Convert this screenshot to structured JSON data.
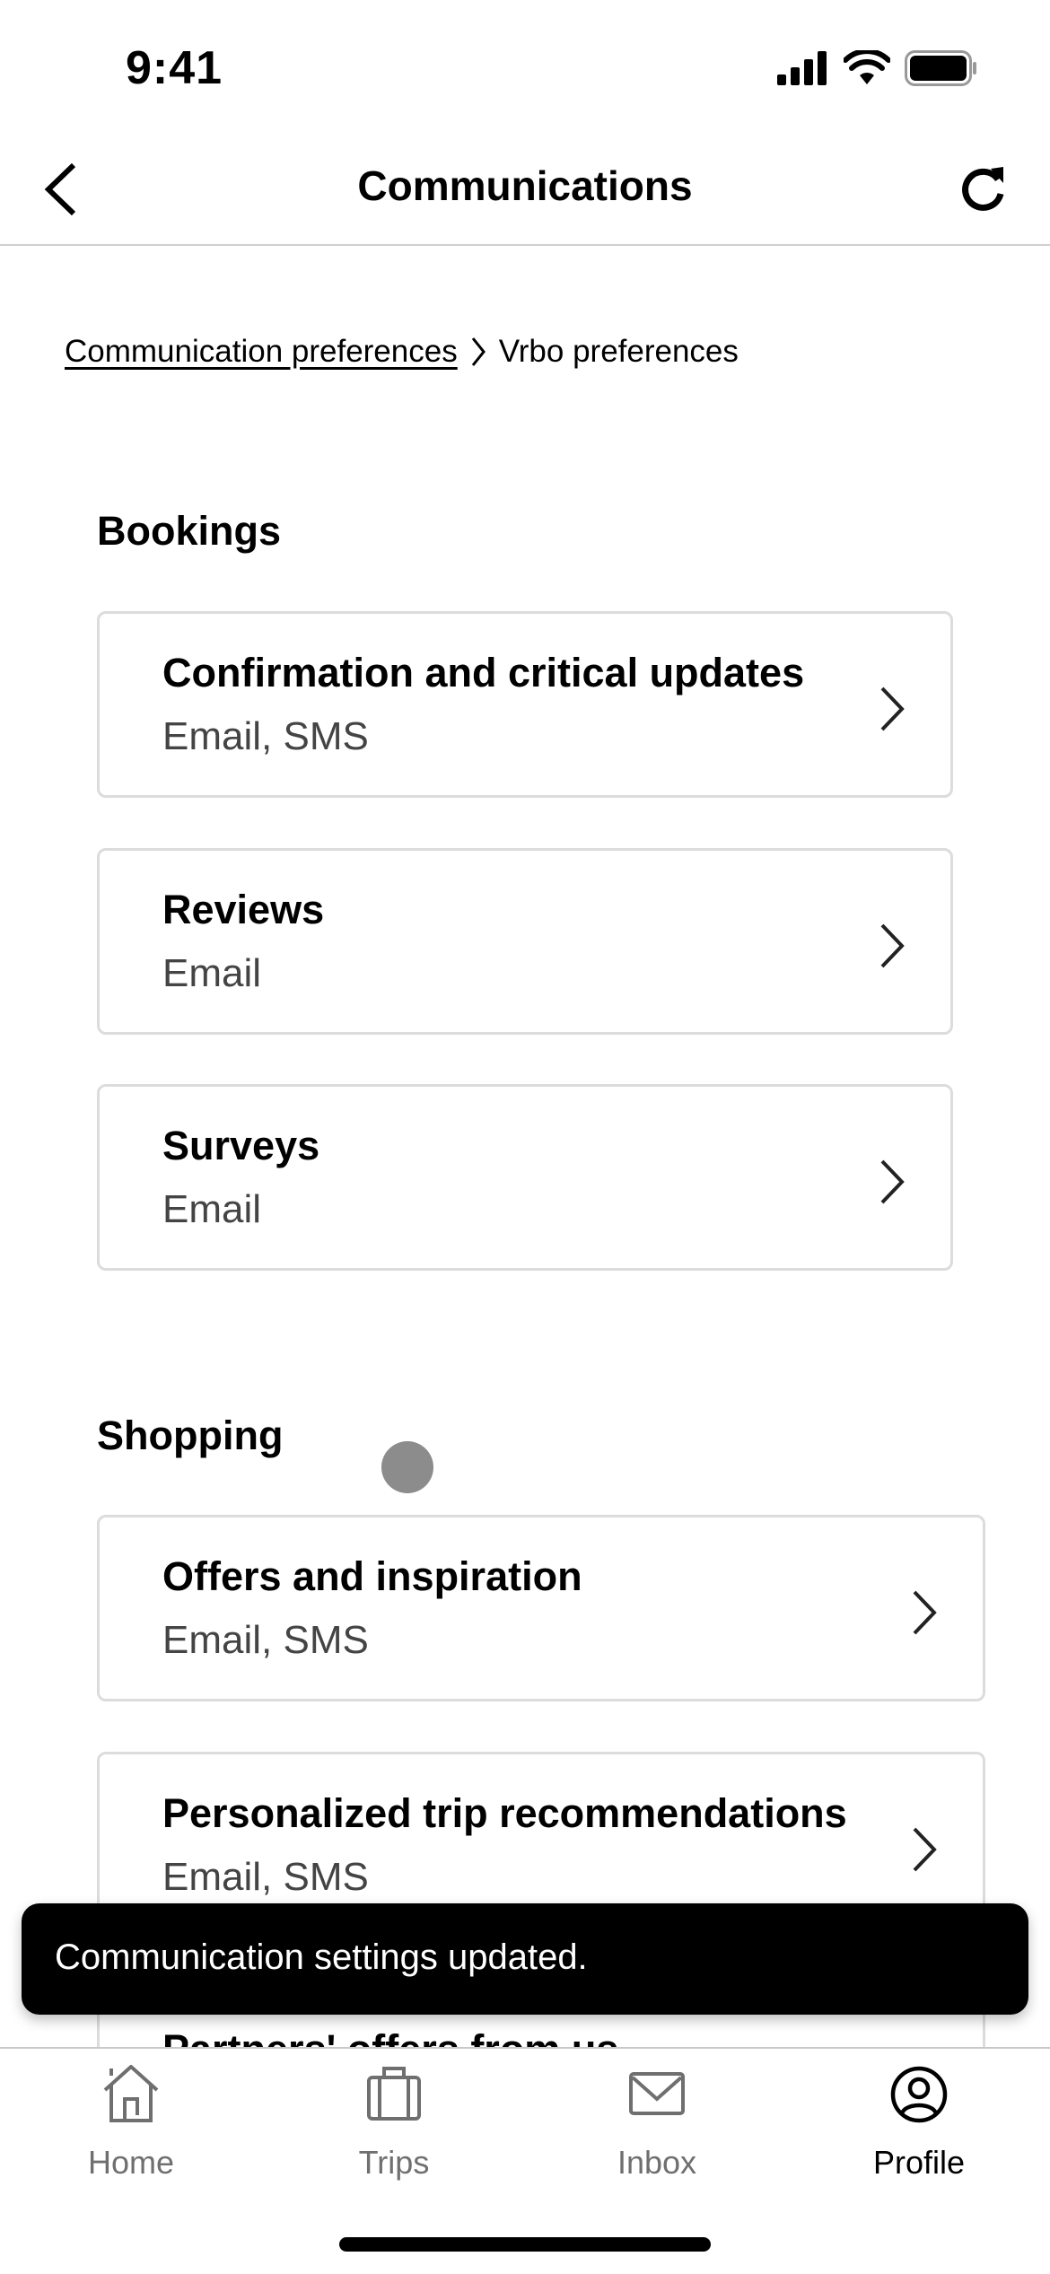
{
  "status_bar": {
    "time": "9:41"
  },
  "nav": {
    "title": "Communications",
    "back_icon": "chevron-left-icon",
    "refresh_icon": "refresh-icon"
  },
  "breadcrumb": {
    "parent": "Communication preferences",
    "current": "Vrbo preferences"
  },
  "sections": [
    {
      "title": "Bookings",
      "items": [
        {
          "title": "Confirmation and critical updates",
          "channels": "Email, SMS"
        },
        {
          "title": "Reviews",
          "channels": "Email"
        },
        {
          "title": "Surveys",
          "channels": "Email"
        }
      ]
    },
    {
      "title": "Shopping",
      "items": [
        {
          "title": "Offers and inspiration",
          "channels": "Email, SMS"
        },
        {
          "title": "Personalized trip recommendations",
          "channels": "Email, SMS"
        },
        {
          "title": "Partners' offers from us",
          "channels": ""
        }
      ]
    }
  ],
  "toast": {
    "message": "Communication settings updated."
  },
  "tab_bar": {
    "tabs": [
      {
        "label": "Home",
        "icon": "home-icon",
        "active": false
      },
      {
        "label": "Trips",
        "icon": "suitcase-icon",
        "active": false
      },
      {
        "label": "Inbox",
        "icon": "mail-icon",
        "active": false
      },
      {
        "label": "Profile",
        "icon": "profile-icon",
        "active": true
      }
    ]
  }
}
